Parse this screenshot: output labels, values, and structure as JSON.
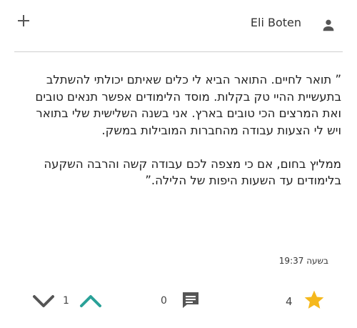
{
  "header": {
    "add_icon": "plus-icon",
    "author_name": "Eli Boten",
    "avatar_icon": "person-icon"
  },
  "review": {
    "text": "” תואר לחיים. התואר הביא לי כלים שאיתם יכולתי להשתלב בתעשיית ההיי טק בקלות. מוסד הלימודים אפשר תנאים טובים ואת המרצים הכי טובים בארץ. אני בשנה השלישית שלי בתואר ויש לי הצעות עבודה מהחברות המובילות במשק.\n\nממליץ בחום, אם כי מצפה לכם עבודה קשה והרבה השקעה בלימודים עד השעות היפות של הלילה.”",
    "timestamp": "בשעה 19:37"
  },
  "actions": {
    "downvote_icon": "chevron-down-icon",
    "vote_count": "1",
    "upvote_icon": "chevron-up-icon",
    "comment_count": "0",
    "comment_icon": "comment-icon",
    "rating_count": "4",
    "star_icon": "star-icon"
  },
  "colors": {
    "upvote": "#2aa198",
    "star": "#f5b81c",
    "icon_gray": "#555555",
    "divider": "#cfcfcf"
  }
}
